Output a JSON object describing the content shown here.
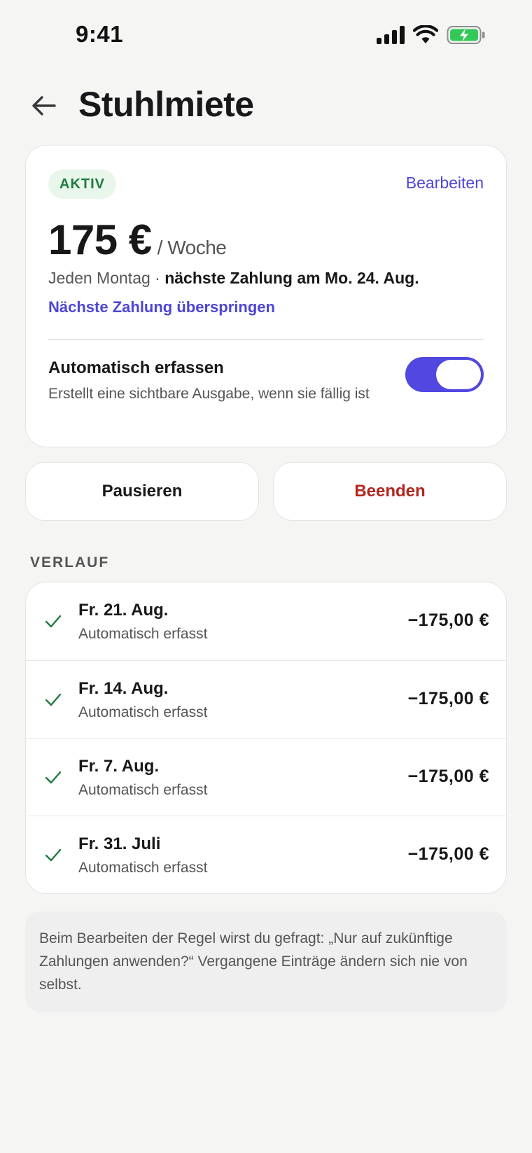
{
  "status_bar": {
    "time": "9:41"
  },
  "header": {
    "title": "Stuhlmiete"
  },
  "rule": {
    "status_badge": "AKTIV",
    "edit_label": "Bearbeiten",
    "amount": "175 €",
    "period": "/ Woche",
    "schedule_prefix": "Jeden Montag · ",
    "next_payment": "nächste Zahlung am Mo. 24. Aug.",
    "skip_label": "Nächste Zahlung überspringen",
    "auto_title": "Automatisch erfassen",
    "auto_desc": "Erstellt eine sichtbare Ausgabe, wenn sie fällig ist",
    "auto_enabled": true
  },
  "actions": {
    "pause_label": "Pausieren",
    "end_label": "Beenden"
  },
  "history": {
    "section_label": "VERLAUF",
    "items": [
      {
        "date": "Fr. 21. Aug.",
        "status": "Automatisch erfasst",
        "amount": "−175,00 €"
      },
      {
        "date": "Fr. 14. Aug.",
        "status": "Automatisch erfasst",
        "amount": "−175,00 €"
      },
      {
        "date": "Fr. 7. Aug.",
        "status": "Automatisch erfasst",
        "amount": "−175,00 €"
      },
      {
        "date": "Fr. 31. Juli",
        "status": "Automatisch erfasst",
        "amount": "−175,00 €"
      }
    ]
  },
  "note": "Beim Bearbeiten der Regel wirst du gefragt: „Nur auf zukünftige Zahlungen anwenden?“ Vergangene Einträge ändern sich nie von selbst.",
  "colors": {
    "accent": "#5147e1",
    "success": "#1f7a3d",
    "danger": "#b3261e",
    "background": "#f5f5f4"
  }
}
